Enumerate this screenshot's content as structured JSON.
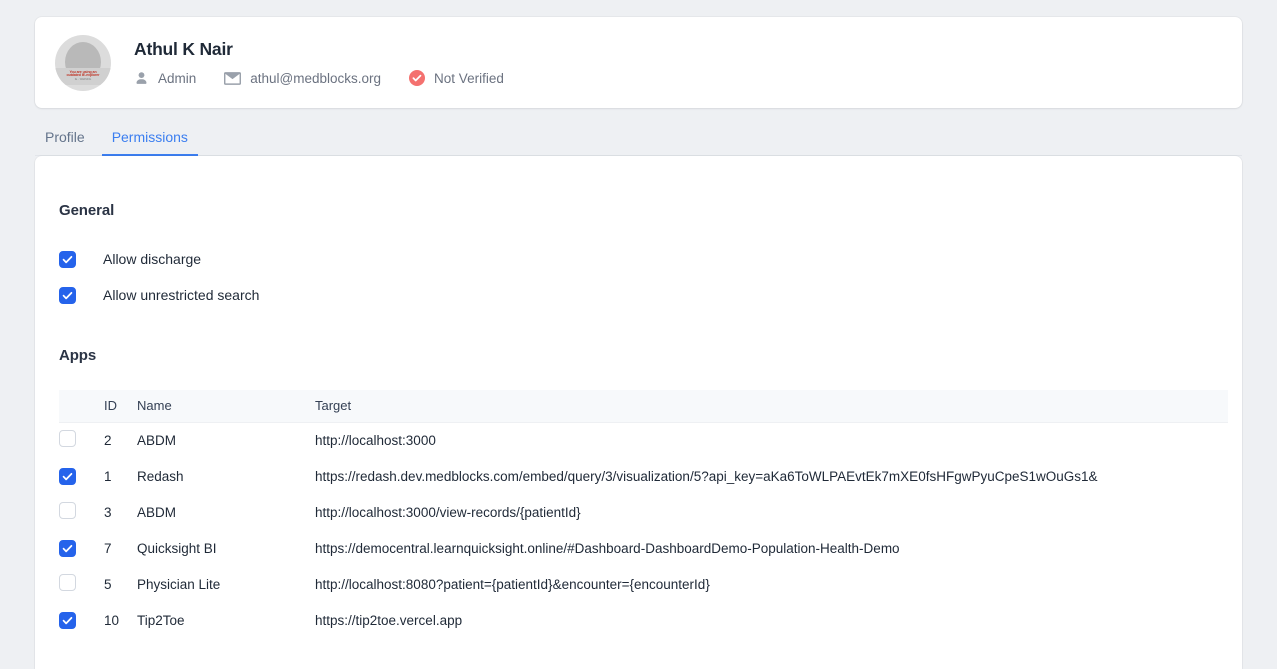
{
  "profile": {
    "name": "Athul K Nair",
    "avatar": {
      "banner_line1": "You are using an",
      "banner_line2": "outdated IE-explorer",
      "banner_line3": "IE... WARNING"
    },
    "role": "Admin",
    "email": "athul@medblocks.org",
    "verification_status": "Not Verified",
    "verification_color": "#f4716f"
  },
  "tabs": [
    {
      "label": "Profile",
      "active": false
    },
    {
      "label": "Permissions",
      "active": true
    }
  ],
  "accent_color": "#3b7ef0",
  "checkbox_color": "#2563eb",
  "general": {
    "title": "General",
    "options": [
      {
        "label": "Allow discharge",
        "checked": true
      },
      {
        "label": "Allow unrestricted search",
        "checked": true
      }
    ]
  },
  "apps": {
    "title": "Apps",
    "columns": [
      "",
      "ID",
      "Name",
      "Target"
    ],
    "rows": [
      {
        "checked": false,
        "id": "2",
        "name": "ABDM",
        "target": "http://localhost:3000"
      },
      {
        "checked": true,
        "id": "1",
        "name": "Redash",
        "target": "https://redash.dev.medblocks.com/embed/query/3/visualization/5?api_key=aKa6ToWLPAEvtEk7mXE0fsHFgwPyuCpeS1wOuGs1&"
      },
      {
        "checked": false,
        "id": "3",
        "name": "ABDM",
        "target": "http://localhost:3000/view-records/{patientId}"
      },
      {
        "checked": true,
        "id": "7",
        "name": "Quicksight BI",
        "target": "https://democentral.learnquicksight.online/#Dashboard-DashboardDemo-Population-Health-Demo"
      },
      {
        "checked": false,
        "id": "5",
        "name": "Physician Lite",
        "target": "http://localhost:8080?patient={patientId}&encounter={encounterId}"
      },
      {
        "checked": true,
        "id": "10",
        "name": "Tip2Toe",
        "target": "https://tip2toe.vercel.app"
      }
    ]
  }
}
